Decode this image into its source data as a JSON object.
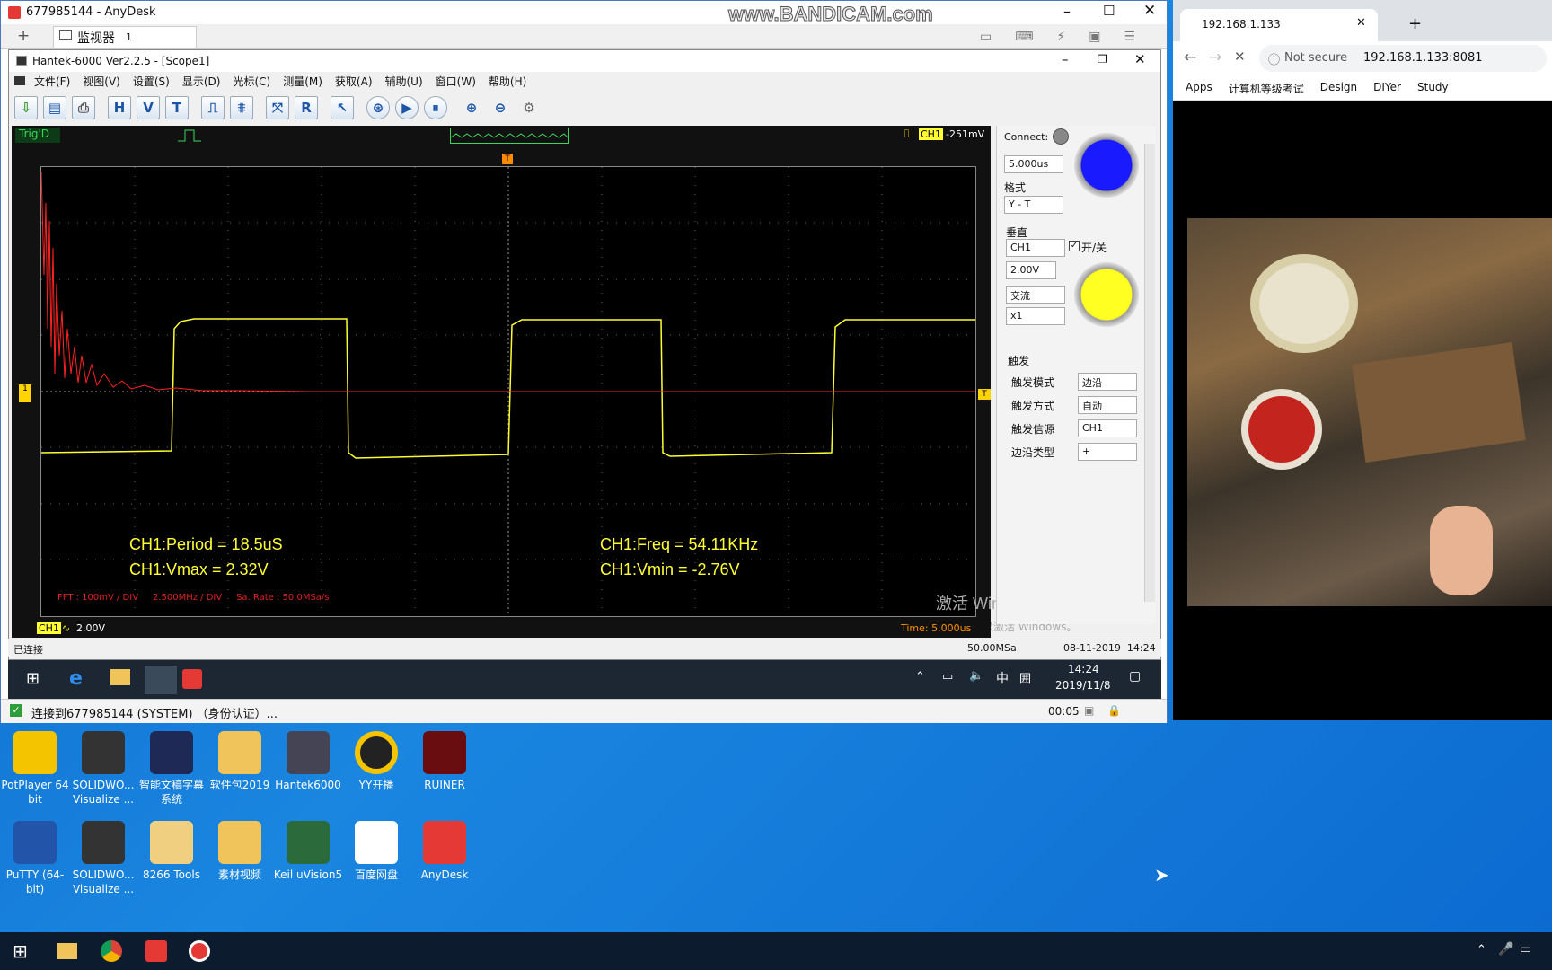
{
  "anydesk": {
    "title": "677985144 - AnyDesk",
    "tab_label": "监视器",
    "tab_count": "1",
    "watermark": "www.BANDICAM.com",
    "status": "连接到677985144 (SYSTEM) （身份认证）...",
    "timer": "00:05"
  },
  "hantek": {
    "title": "Hantek-6000 Ver2.2.5 - [Scope1]",
    "menu": [
      "文件(F)",
      "视图(V)",
      "设置(S)",
      "显示(D)",
      "光标(C)",
      "测量(M)",
      "获取(A)",
      "辅助(U)",
      "窗口(W)",
      "帮助(H)"
    ],
    "trig_state": "Trig'D",
    "trig_channel": "CH1",
    "trig_level": "-251mV",
    "ch_scale_label": "CH1",
    "ch_scale_value": "2.00V",
    "time_label": "Time: 5.000us",
    "measurements": {
      "period": "CH1:Period = 18.5uS",
      "vmax": "CH1:Vmax = 2.32V",
      "freq": "CH1:Freq = 54.11KHz",
      "vmin": "CH1:Vmin = -2.76V"
    },
    "fft_info": "FFT : 100mV / DIV     2.500MHz / DIV     Sa. Rate : 50.0MSa/s",
    "activate_windows": "激活 Windows",
    "activate_hint": "转到\"设置\"以激活 Windows。",
    "status_left": "已连接",
    "status_rate": "50.00MSa",
    "status_datetime": "08-11-2019  14:24",
    "panel": {
      "connect_label": "Connect:",
      "timebase": "5.000us",
      "format_label": "格式",
      "format_value": "Y - T",
      "vertical_label": "垂直",
      "channel": "CH1",
      "onoff_label": "开/关",
      "volts": "2.00V",
      "coupling": "交流",
      "probe": "x1",
      "trigger_label": "触发",
      "trig_mode_label": "触发模式",
      "trig_mode": "边沿",
      "trig_sweep_label": "触发方式",
      "trig_sweep": "自动",
      "trig_source_label": "触发信源",
      "trig_source": "CH1",
      "edge_type_label": "边沿类型",
      "edge_type": "+"
    }
  },
  "remote_taskbar": {
    "ime": "中",
    "time": "14:24",
    "date": "2019/11/8"
  },
  "browser": {
    "tab_title": "192.168.1.133",
    "not_secure": "Not secure",
    "url": "192.168.1.133:8081",
    "bookmarks": [
      "Apps",
      "计算机等级考试",
      "Design",
      "DIYer",
      "Study"
    ]
  },
  "desktop_icons": [
    {
      "label": "PotPlayer 64 bit",
      "color": "#f5c400"
    },
    {
      "label": "SOLIDWO... Visualize ...",
      "color": "#333"
    },
    {
      "label": "智能文稿字幕系统",
      "color": "#1e2a55"
    },
    {
      "label": "软件包2019",
      "color": "#f0c45a"
    },
    {
      "label": "Hantek6000",
      "color": "#445"
    },
    {
      "label": "YY开播",
      "color": "#222"
    },
    {
      "label": "RUINER",
      "color": "#6a0d10"
    },
    {
      "label": "PuTTY (64-bit)",
      "color": "#2255aa"
    },
    {
      "label": "SOLIDWO... Visualize ...",
      "color": "#333"
    },
    {
      "label": "8266 Tools",
      "color": "#f0d080"
    },
    {
      "label": "素材视频",
      "color": "#f0c45a"
    },
    {
      "label": "Keil uVision5",
      "color": "#2b6a3a"
    },
    {
      "label": "百度网盘",
      "color": "#fff"
    },
    {
      "label": "AnyDesk",
      "color": "#e53935"
    }
  ]
}
